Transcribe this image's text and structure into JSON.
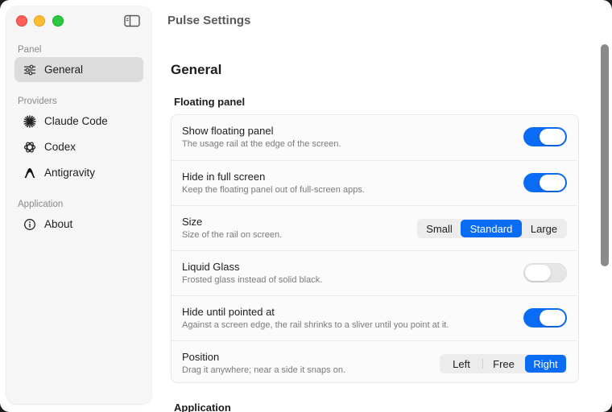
{
  "window": {
    "title": "Pulse Settings"
  },
  "sidebar": {
    "sections": [
      {
        "label": "Panel",
        "items": [
          {
            "label": "General",
            "icon": "sliders-icon",
            "active": true
          }
        ]
      },
      {
        "label": "Providers",
        "items": [
          {
            "label": "Claude Code",
            "icon": "claude-burst-icon"
          },
          {
            "label": "Codex",
            "icon": "openai-knot-icon"
          },
          {
            "label": "Antigravity",
            "icon": "antigravity-arch-icon"
          }
        ]
      },
      {
        "label": "Application",
        "items": [
          {
            "label": "About",
            "icon": "info-circle-icon"
          }
        ]
      }
    ]
  },
  "main": {
    "heading": "General",
    "floating_panel": {
      "heading": "Floating panel",
      "rows": [
        {
          "title": "Show floating panel",
          "subtitle": "The usage rail at the edge of the screen.",
          "control": "toggle",
          "on": true
        },
        {
          "title": "Hide in full screen",
          "subtitle": "Keep the floating panel out of full-screen apps.",
          "control": "toggle",
          "on": true
        },
        {
          "title": "Size",
          "subtitle": "Size of the rail on screen.",
          "control": "segmented",
          "options": [
            "Small",
            "Standard",
            "Large"
          ],
          "selected": "Standard"
        },
        {
          "title": "Liquid Glass",
          "subtitle": "Frosted glass instead of solid black.",
          "control": "toggle",
          "on": false
        },
        {
          "title": "Hide until pointed at",
          "subtitle": "Against a screen edge, the rail shrinks to a sliver until you point at it.",
          "control": "toggle",
          "on": true
        },
        {
          "title": "Position",
          "subtitle": "Drag it anywhere; near a side it snaps on.",
          "control": "segmented",
          "options": [
            "Left",
            "Free",
            "Right"
          ],
          "selected": "Right"
        }
      ]
    },
    "application_heading": "Application"
  },
  "colors": {
    "accent": "#0a6cf5",
    "close": "#ff5f57",
    "minimize": "#febc2e",
    "maximize": "#28c840"
  }
}
